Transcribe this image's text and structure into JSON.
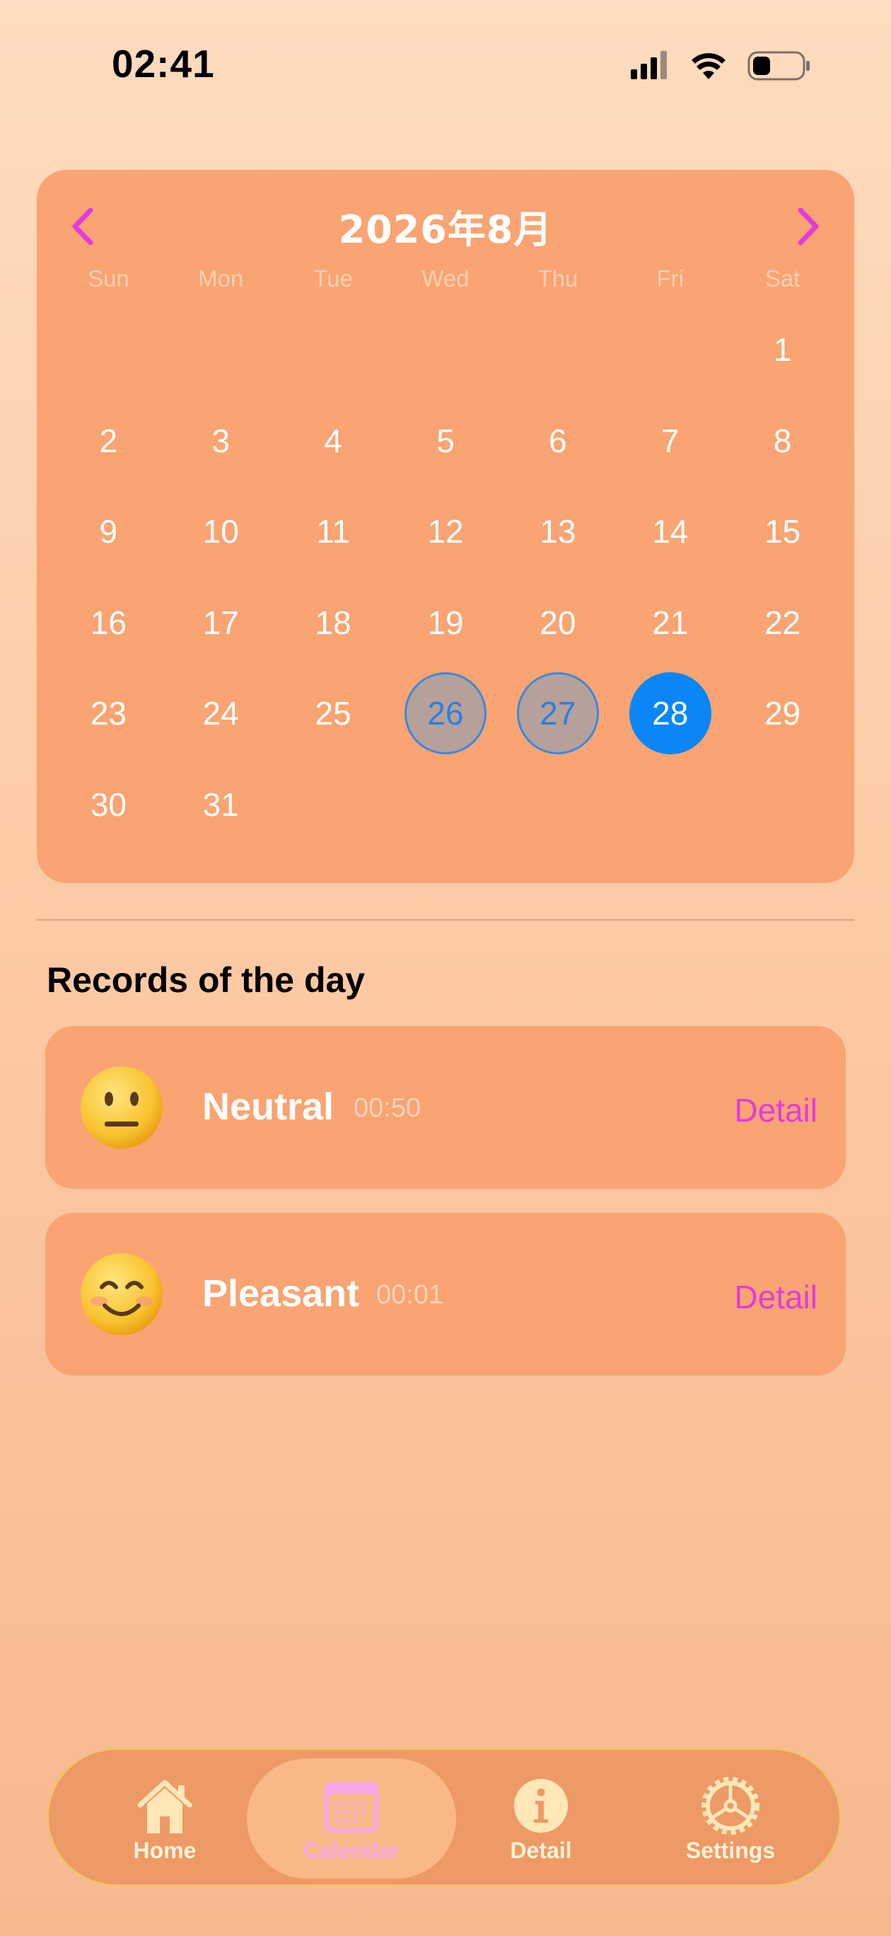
{
  "status_bar": {
    "time": "02:41"
  },
  "calendar": {
    "title": "2026年8月",
    "weekdays": [
      "Sun",
      "Mon",
      "Tue",
      "Wed",
      "Thu",
      "Fri",
      "Sat"
    ],
    "days": [
      "1",
      "2",
      "3",
      "4",
      "5",
      "6",
      "7",
      "8",
      "9",
      "10",
      "11",
      "12",
      "13",
      "14",
      "15",
      "16",
      "17",
      "18",
      "19",
      "20",
      "21",
      "22",
      "23",
      "24",
      "25",
      "26",
      "27",
      "28",
      "29",
      "30",
      "31"
    ],
    "marked_days": [
      "26",
      "27"
    ],
    "selected_day": "28"
  },
  "records": {
    "title": "Records of the day",
    "items": [
      {
        "mood": "Neutral",
        "time": "00:50",
        "emoji": "neutral-face",
        "detail_label": "Detail"
      },
      {
        "mood": "Pleasant",
        "time": "00:01",
        "emoji": "smiling-face",
        "detail_label": "Detail"
      }
    ]
  },
  "tabbar": {
    "items": [
      {
        "label": "Home",
        "icon": "home-icon"
      },
      {
        "label": "Calendar",
        "icon": "calendar-icon",
        "active": true
      },
      {
        "label": "Detail",
        "icon": "info-icon"
      },
      {
        "label": "Settings",
        "icon": "gear-icon"
      }
    ]
  },
  "colors": {
    "accent": "#E03BE0",
    "card": "#F9A472",
    "selected": "#0A86F7",
    "marked_ring": "#3A89E0"
  }
}
